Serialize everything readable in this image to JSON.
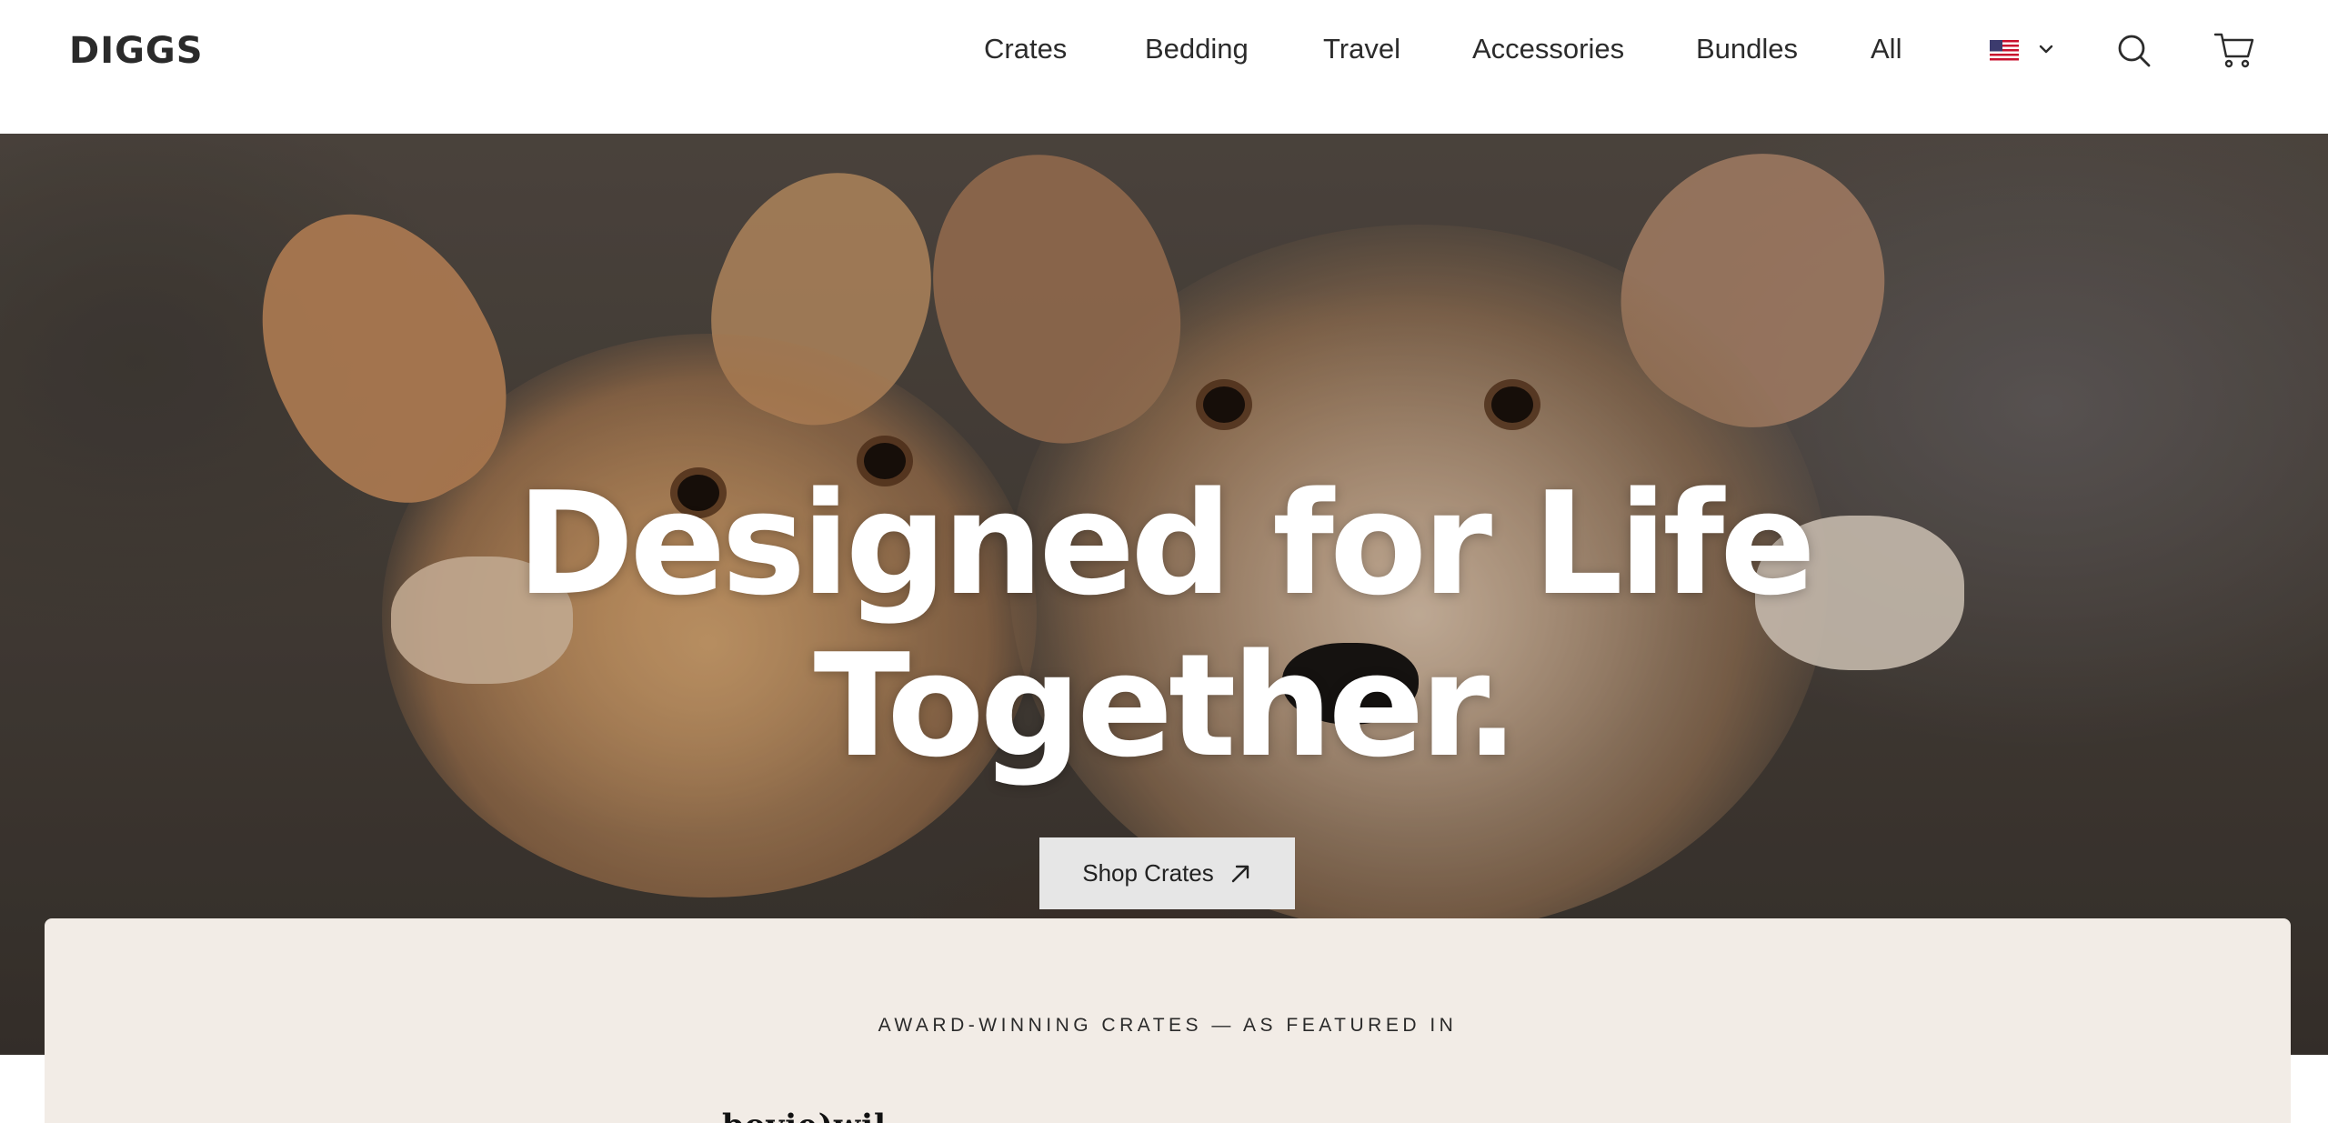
{
  "brand": {
    "logo_text": "DIGGS"
  },
  "nav": {
    "items": [
      {
        "label": "Crates"
      },
      {
        "label": "Bedding"
      },
      {
        "label": "Travel"
      },
      {
        "label": "Accessories"
      },
      {
        "label": "Bundles"
      },
      {
        "label": "All"
      }
    ],
    "region": {
      "flag": "us-flag-icon"
    },
    "icons": {
      "search": "search-icon",
      "cart": "cart-icon"
    }
  },
  "hero": {
    "title_line1": "Designed for Life",
    "title_line2": "Together.",
    "cta_label": "Shop Crates",
    "cta_icon": "arrow-up-right-icon"
  },
  "featured": {
    "label": "AWARD-WINNING CRATES — AS FEATURED IN",
    "partial_logo": "bovie)wil "
  },
  "colors": {
    "header_bg": "#ffffff",
    "cta_bg": "#e6e6e6",
    "featured_bg": "#f2ece6",
    "hero_text": "#ffffff"
  }
}
